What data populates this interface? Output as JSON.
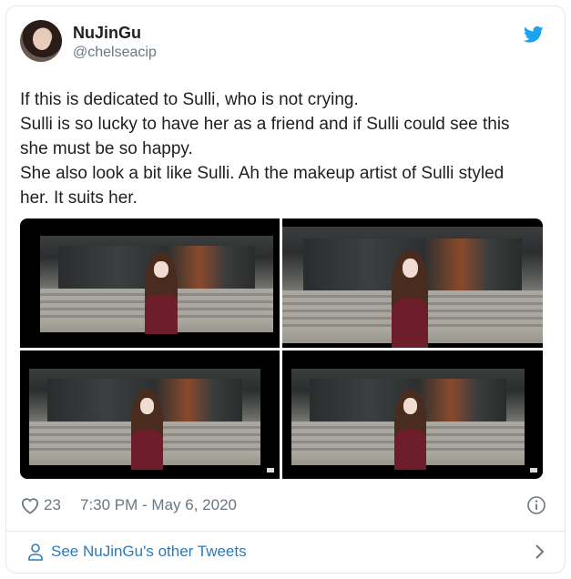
{
  "user": {
    "display_name": "NuJinGu",
    "handle": "@chelseacip",
    "avatar_icon": "user-avatar"
  },
  "tweet": {
    "lines": [
      "If this is dedicated to Sulli, who is not crying.",
      "Sulli is so lucky to have her as a friend and if Sulli could  see this",
      "she must be so happy.",
      "She also look a bit like Sulli. Ah the makeup artist of Sulli styled",
      "her. It suits her."
    ],
    "media": {
      "count": 4,
      "description_icons": [
        "video-still-1",
        "video-still-2",
        "video-still-3",
        "video-still-4"
      ]
    }
  },
  "meta": {
    "likes": "23",
    "timestamp": "7:30 PM - May 6, 2020",
    "like_icon": "heart-icon",
    "info_icon": "info-icon"
  },
  "footer": {
    "link_text": "See NuJinGu's other Tweets",
    "person_icon": "person-icon",
    "chevron_icon": "chevron-right-icon"
  },
  "colors": {
    "text": "#1c2022",
    "secondary": "#697882",
    "link": "#2b7bb9",
    "twitter_blue": "#1da1f2",
    "border": "#e1e8ed"
  }
}
